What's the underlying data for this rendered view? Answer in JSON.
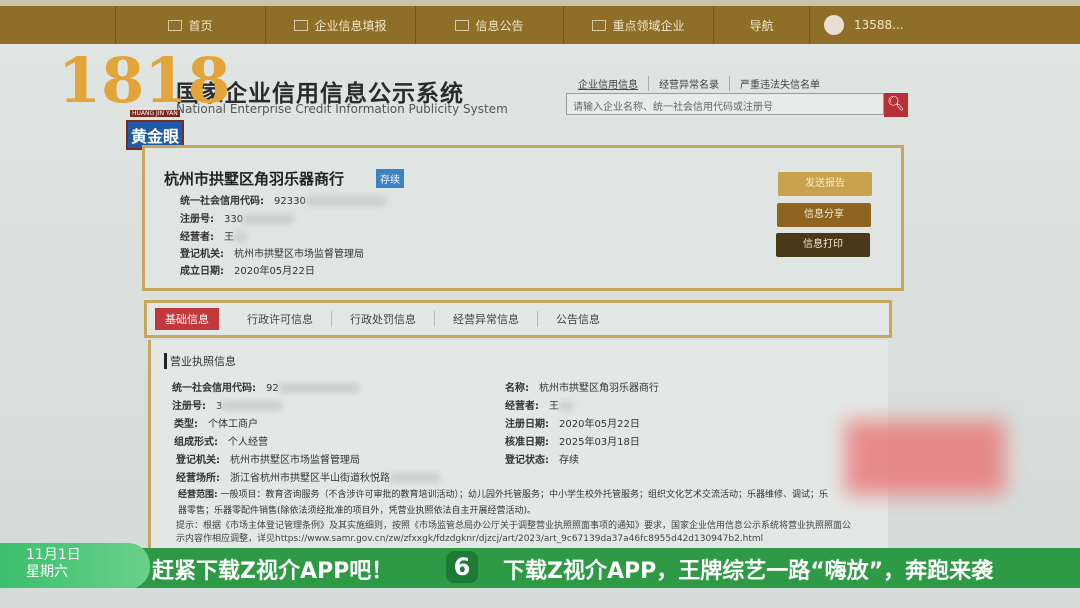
{
  "nav": {
    "items": [
      "首页",
      "企业信息填报",
      "信息公告",
      "重点领域企业",
      "导航"
    ],
    "user": "13588..."
  },
  "header": {
    "title": "国家企业信用信息公示系统",
    "subtitle": "National Enterprise Credit Information Publicity System"
  },
  "overlay_logo": {
    "number": "1818",
    "pinyin": "HUANG JIN YAN",
    "name": "黄金眼"
  },
  "search": {
    "tabs": [
      "企业信用信息",
      "经营异常名录",
      "严重违法失信名单"
    ],
    "placeholder": "请输入企业名称、统一社会信用代码或注册号"
  },
  "company": {
    "name": "杭州市拱墅区角羽乐器商行",
    "status": "存续",
    "fields": [
      {
        "label": "统一社会信用代码:",
        "value": "92330"
      },
      {
        "label": "注册号:",
        "value": "330"
      },
      {
        "label": "经营者:",
        "value": "王"
      },
      {
        "label": "登记机关:",
        "value": "杭州市拱墅区市场监督管理局"
      },
      {
        "label": "成立日期:",
        "value": "2020年05月22日"
      }
    ],
    "buttons": [
      "发送报告",
      "信息分享",
      "信息打印"
    ]
  },
  "tabs": [
    "基础信息",
    "行政许可信息",
    "行政处罚信息",
    "经营异常信息",
    "公告信息"
  ],
  "license": {
    "title": "营业执照信息",
    "left": [
      {
        "label": "统一社会信用代码:",
        "value": "92"
      },
      {
        "label": "注册号:",
        "value": "3"
      },
      {
        "label": "类型:",
        "value": "个体工商户"
      },
      {
        "label": "组成形式:",
        "value": "个人经营"
      },
      {
        "label": "登记机关:",
        "value": "杭州市拱墅区市场监督管理局"
      },
      {
        "label": "经营场所:",
        "value": "浙江省杭州市拱墅区半山街道秋悦路"
      }
    ],
    "right": [
      {
        "label": "名称:",
        "value": "杭州市拱墅区角羽乐器商行"
      },
      {
        "label": "经营者:",
        "value": "王"
      },
      {
        "label": "注册日期:",
        "value": "2020年05月22日"
      },
      {
        "label": "核准日期:",
        "value": "2025年03月18日"
      },
      {
        "label": "登记状态:",
        "value": "存续"
      }
    ],
    "scope_label": "经营范围:",
    "scope": "一般项目：教育咨询服务（不含涉许可审批的教育培训活动）；幼儿园外托管服务；中小学生校外托管服务；组织文化艺术交流活动；乐器维修、调试；乐器零售；乐器零配件销售(除依法须经批准的项目外，凭营业执照依法自主开展经营活动)。",
    "tip": "提示：根据《市场主体登记管理条例》及其实施细则，按照《市场监管总局办公厅关于调整营业执照照面事项的通知》要求，国家企业信用信息公示系统将营业执照照面公示内容作相应调整，详见https://www.samr.gov.cn/zw/zfxxgk/fdzdgknr/djzcj/art/2023/art_9c67139da37a46fc8955d42d130947b2.html"
  },
  "broadcast": {
    "date": "11月1日",
    "weekday": "星期六",
    "ticker1": "赶紧下载Z视介APP吧！",
    "channel": "6",
    "ticker2": "下载Z视介APP，王牌综艺一路“嗨放”，奔跑来袭"
  }
}
